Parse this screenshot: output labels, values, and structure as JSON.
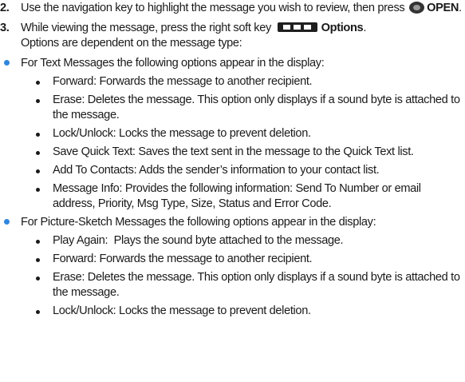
{
  "steps": [
    {
      "number": "2.",
      "text_before": "Use the navigation key to highlight the message you wish to review, then press",
      "key_label": "OPEN",
      "text_after": "."
    },
    {
      "number": "3.",
      "text_before": "While viewing the message, press the right soft key",
      "key_label": "Options",
      "text_after": ".",
      "line2": "Options are dependent on the message type:"
    }
  ],
  "sections": [
    {
      "heading": "For Text Messages the following options appear in the display:",
      "items": [
        "Forward: Forwards the message to another recipient.",
        "Erase: Deletes the message. This option only displays if a sound byte is attached to the message.",
        "Lock/Unlock: Locks the message to prevent deletion.",
        "Save Quick Text: Saves the text sent in the message to the Quick Text list.",
        "Add To Contacts: Adds the sender’s information to your contact list.",
        "Message Info: Provides the following information: Send To Number or email address, Priority, Msg Type, Size, Status and Error Code."
      ]
    },
    {
      "heading": "For Picture-Sketch Messages the following options appear in the display:",
      "items": [
        "Play Again:  Plays the sound byte attached to the message.",
        "Forward: Forwards the message to another recipient.",
        "Erase: Deletes the message. This option only displays if a sound byte is attached to the message.",
        "Lock/Unlock: Locks the message to prevent deletion."
      ]
    }
  ],
  "icons": {
    "open_key": "ok-key-icon",
    "right_soft_key": "right-soft-key-icon"
  },
  "colors": {
    "bullet_accent": "#2e86de",
    "text": "#1a1a1a"
  }
}
